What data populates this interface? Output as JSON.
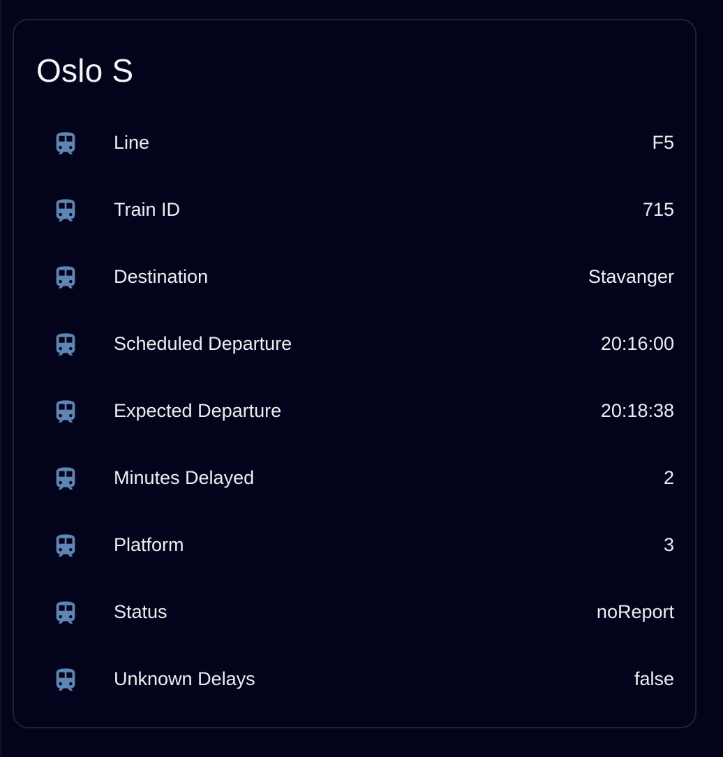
{
  "card": {
    "title": "Oslo S",
    "icon": "train-icon",
    "icon_color": "#5f86b3",
    "rows": [
      {
        "label": "Line",
        "value": "F5"
      },
      {
        "label": "Train ID",
        "value": "715"
      },
      {
        "label": "Destination",
        "value": "Stavanger"
      },
      {
        "label": "Scheduled Departure",
        "value": "20:16:00"
      },
      {
        "label": "Expected Departure",
        "value": "20:18:38"
      },
      {
        "label": "Minutes Delayed",
        "value": "2"
      },
      {
        "label": "Platform",
        "value": "3"
      },
      {
        "label": "Status",
        "value": "noReport"
      },
      {
        "label": "Unknown Delays",
        "value": "false"
      }
    ]
  }
}
